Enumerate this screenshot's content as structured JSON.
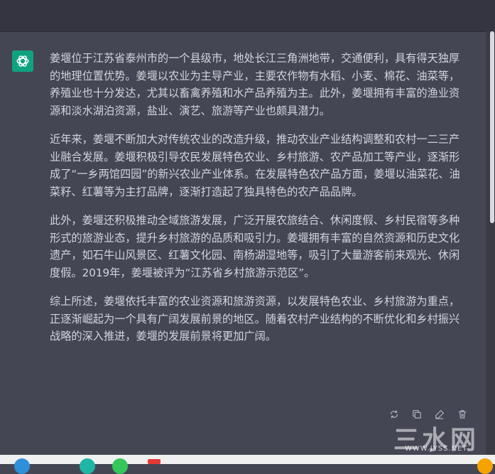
{
  "message": {
    "paragraphs": [
      "姜堰位于江苏省泰州市的一个县级市，地处长江三角洲地带，交通便利，具有得天独厚的地理位置优势。姜堰以农业为主导产业，主要农作物有水稻、小麦、棉花、油菜等，养殖业也十分发达，尤其以畜禽养殖和水产品养殖为主。此外，姜堰拥有丰富的渔业资源和淡水湖泊资源，盐业、演艺、旅游等产业也颇具潜力。",
      "近年来，姜堰不断加大对传统农业的改造升级，推动农业产业结构调整和农村一二三产业融合发展。姜堰积极引导农民发展特色农业、乡村旅游、农产品加工等产业，逐渐形成了“一乡两馆四园”的新兴农业产业体系。在发展特色农产品方面，姜堰以油菜花、油菜籽、红薯等为主打品牌，逐渐打造起了独具特色的农产品品牌。",
      "此外，姜堰还积极推动全域旅游发展，广泛开展农旅结合、休闲度假、乡村民宿等多种形式的旅游业态，提升乡村旅游的品质和吸引力。姜堰拥有丰富的自然资源和历史文化遗产，如石牛山风景区、红薯文化园、南杨湖湿地等，吸引了大量游客前来观光、休闲度假。2019年，姜堰被评为“江苏省乡村旅游示范区”。",
      "综上所述，姜堰依托丰富的农业资源和旅游资源，以发展特色农业、乡村旅游为重点，正逐渐崛起为一个具有广阔发展前景的地区。随着农村产业结构的不断优化和乡村振兴战略的深入推进，姜堰的发展前景将更加广阔。"
    ]
  },
  "actions": {
    "icons": [
      "regenerate-icon",
      "copy-icon",
      "edit-icon",
      "delete-icon"
    ]
  },
  "watermark": {
    "logo_text": "三水网",
    "url_text": "WWW.JYSS.NET"
  },
  "colors": {
    "background": "#444654",
    "text": "#d1d5db",
    "avatar": "#10a37f",
    "topbar": "#343541"
  }
}
